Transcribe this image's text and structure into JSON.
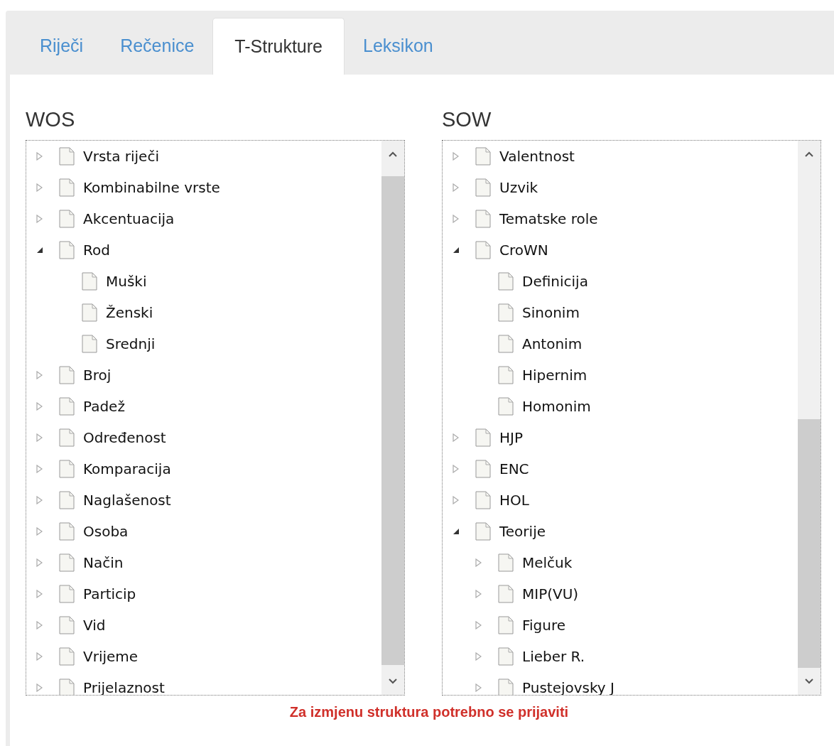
{
  "tabs": [
    {
      "label": "Riječi",
      "selected": false
    },
    {
      "label": "Rečenice",
      "selected": false
    },
    {
      "label": "T-Strukture",
      "selected": true
    },
    {
      "label": "Leksikon",
      "selected": false
    }
  ],
  "panels": [
    {
      "title": "WOS",
      "items": [
        {
          "label": "Vrsta riječi",
          "kind": "folder",
          "expanded": false
        },
        {
          "label": "Kombinabilne vrste",
          "kind": "folder",
          "expanded": false
        },
        {
          "label": "Akcentuacija",
          "kind": "folder",
          "expanded": false
        },
        {
          "label": "Rod",
          "kind": "folder",
          "expanded": true,
          "children": [
            {
              "label": "Muški",
              "kind": "leaf"
            },
            {
              "label": "Ženski",
              "kind": "leaf"
            },
            {
              "label": "Srednji",
              "kind": "leaf"
            }
          ]
        },
        {
          "label": "Broj",
          "kind": "folder",
          "expanded": false
        },
        {
          "label": "Padež",
          "kind": "folder",
          "expanded": false
        },
        {
          "label": "Određenost",
          "kind": "folder",
          "expanded": false
        },
        {
          "label": "Komparacija",
          "kind": "folder",
          "expanded": false
        },
        {
          "label": "Naglašenost",
          "kind": "folder",
          "expanded": false
        },
        {
          "label": "Osoba",
          "kind": "folder",
          "expanded": false
        },
        {
          "label": "Način",
          "kind": "folder",
          "expanded": false
        },
        {
          "label": "Particip",
          "kind": "folder",
          "expanded": false
        },
        {
          "label": "Vid",
          "kind": "folder",
          "expanded": false
        },
        {
          "label": "Vrijeme",
          "kind": "folder",
          "expanded": false
        },
        {
          "label": "Prijelaznost",
          "kind": "folder",
          "expanded": false
        }
      ]
    },
    {
      "title": "SOW",
      "items": [
        {
          "label": "Valentnost",
          "kind": "folder",
          "expanded": false
        },
        {
          "label": "Uzvik",
          "kind": "folder",
          "expanded": false
        },
        {
          "label": "Tematske role",
          "kind": "folder",
          "expanded": false
        },
        {
          "label": "CroWN",
          "kind": "folder",
          "expanded": true,
          "children": [
            {
              "label": "Definicija",
              "kind": "leaf"
            },
            {
              "label": "Sinonim",
              "kind": "leaf"
            },
            {
              "label": "Antonim",
              "kind": "leaf"
            },
            {
              "label": "Hipernim",
              "kind": "leaf"
            },
            {
              "label": "Homonim",
              "kind": "leaf"
            }
          ]
        },
        {
          "label": "HJP",
          "kind": "folder",
          "expanded": false
        },
        {
          "label": "ENC",
          "kind": "folder",
          "expanded": false
        },
        {
          "label": "HOL",
          "kind": "folder",
          "expanded": false
        },
        {
          "label": "Teorije",
          "kind": "folder",
          "expanded": true,
          "children": [
            {
              "label": "Melčuk",
              "kind": "folder",
              "expanded": false
            },
            {
              "label": "MIP(VU)",
              "kind": "folder",
              "expanded": false
            },
            {
              "label": "Figure",
              "kind": "folder",
              "expanded": false
            },
            {
              "label": "Lieber R.",
              "kind": "folder",
              "expanded": false
            },
            {
              "label": "Pustejovsky J",
              "kind": "folder",
              "expanded": false
            }
          ]
        }
      ]
    }
  ],
  "notice": "Za izmjenu struktura potrebno se prijaviti"
}
